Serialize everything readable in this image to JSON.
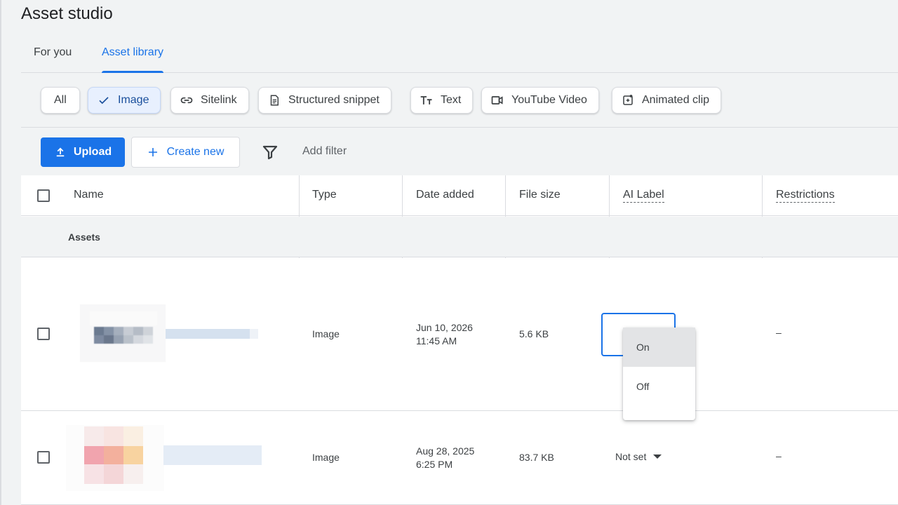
{
  "app": {
    "title": "Asset studio"
  },
  "tabs": [
    {
      "label": "For you",
      "active": false
    },
    {
      "label": "Asset library",
      "active": true
    }
  ],
  "chips": [
    {
      "label": "All",
      "icon": "none",
      "selected": false
    },
    {
      "label": "Image",
      "icon": "check-icon",
      "selected": true
    },
    {
      "label": "Sitelink",
      "icon": "link-icon",
      "selected": false
    },
    {
      "label": "Structured snippet",
      "icon": "document-icon",
      "selected": false
    },
    {
      "label": "Text",
      "icon": "text-format-icon",
      "selected": false
    },
    {
      "label": "YouTube Video",
      "icon": "video-camera-icon",
      "selected": false
    },
    {
      "label": "Animated clip",
      "icon": "animated-clip-icon",
      "selected": false
    }
  ],
  "toolbar": {
    "upload_label": "Upload",
    "create_label": "Create new",
    "add_filter_label": "Add filter"
  },
  "table": {
    "columns": {
      "name": "Name",
      "type": "Type",
      "date_added": "Date added",
      "file_size": "File size",
      "ai_label": "AI Label",
      "restrictions": "Restrictions"
    },
    "section_label": "Assets",
    "rows": [
      {
        "type": "Image",
        "date": "Jun 10, 2026",
        "time": "11:45 AM",
        "size": "5.6 KB",
        "ai_label": "",
        "restrictions": "–"
      },
      {
        "type": "Image",
        "date": "Aug 28, 2025",
        "time": "6:25 PM",
        "size": "83.7 KB",
        "ai_label": "Not set",
        "restrictions": "–"
      }
    ]
  },
  "ai_label_menu": {
    "options": [
      "On",
      "Off"
    ],
    "highlighted": "On"
  },
  "colors": {
    "accent": "#1a73e8",
    "selected_chip_bg": "#e8f0fe",
    "page_bg": "#f1f3f4"
  }
}
